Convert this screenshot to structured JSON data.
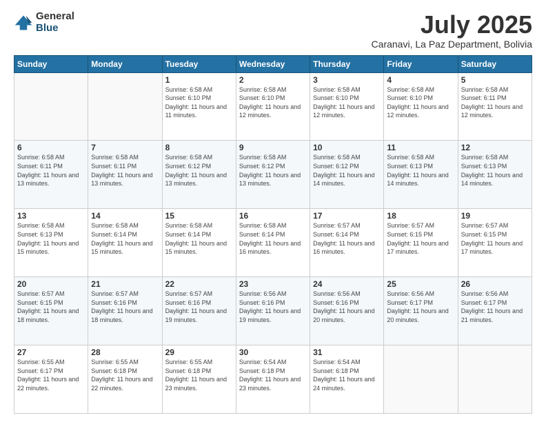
{
  "logo": {
    "general": "General",
    "blue": "Blue"
  },
  "header": {
    "month_year": "July 2025",
    "location": "Caranavi, La Paz Department, Bolivia"
  },
  "days_of_week": [
    "Sunday",
    "Monday",
    "Tuesday",
    "Wednesday",
    "Thursday",
    "Friday",
    "Saturday"
  ],
  "weeks": [
    [
      {
        "day": "",
        "sunrise": "",
        "sunset": "",
        "daylight": ""
      },
      {
        "day": "",
        "sunrise": "",
        "sunset": "",
        "daylight": ""
      },
      {
        "day": "1",
        "sunrise": "Sunrise: 6:58 AM",
        "sunset": "Sunset: 6:10 PM",
        "daylight": "Daylight: 11 hours and 11 minutes."
      },
      {
        "day": "2",
        "sunrise": "Sunrise: 6:58 AM",
        "sunset": "Sunset: 6:10 PM",
        "daylight": "Daylight: 11 hours and 12 minutes."
      },
      {
        "day": "3",
        "sunrise": "Sunrise: 6:58 AM",
        "sunset": "Sunset: 6:10 PM",
        "daylight": "Daylight: 11 hours and 12 minutes."
      },
      {
        "day": "4",
        "sunrise": "Sunrise: 6:58 AM",
        "sunset": "Sunset: 6:10 PM",
        "daylight": "Daylight: 11 hours and 12 minutes."
      },
      {
        "day": "5",
        "sunrise": "Sunrise: 6:58 AM",
        "sunset": "Sunset: 6:11 PM",
        "daylight": "Daylight: 11 hours and 12 minutes."
      }
    ],
    [
      {
        "day": "6",
        "sunrise": "Sunrise: 6:58 AM",
        "sunset": "Sunset: 6:11 PM",
        "daylight": "Daylight: 11 hours and 13 minutes."
      },
      {
        "day": "7",
        "sunrise": "Sunrise: 6:58 AM",
        "sunset": "Sunset: 6:11 PM",
        "daylight": "Daylight: 11 hours and 13 minutes."
      },
      {
        "day": "8",
        "sunrise": "Sunrise: 6:58 AM",
        "sunset": "Sunset: 6:12 PM",
        "daylight": "Daylight: 11 hours and 13 minutes."
      },
      {
        "day": "9",
        "sunrise": "Sunrise: 6:58 AM",
        "sunset": "Sunset: 6:12 PM",
        "daylight": "Daylight: 11 hours and 13 minutes."
      },
      {
        "day": "10",
        "sunrise": "Sunrise: 6:58 AM",
        "sunset": "Sunset: 6:12 PM",
        "daylight": "Daylight: 11 hours and 14 minutes."
      },
      {
        "day": "11",
        "sunrise": "Sunrise: 6:58 AM",
        "sunset": "Sunset: 6:13 PM",
        "daylight": "Daylight: 11 hours and 14 minutes."
      },
      {
        "day": "12",
        "sunrise": "Sunrise: 6:58 AM",
        "sunset": "Sunset: 6:13 PM",
        "daylight": "Daylight: 11 hours and 14 minutes."
      }
    ],
    [
      {
        "day": "13",
        "sunrise": "Sunrise: 6:58 AM",
        "sunset": "Sunset: 6:13 PM",
        "daylight": "Daylight: 11 hours and 15 minutes."
      },
      {
        "day": "14",
        "sunrise": "Sunrise: 6:58 AM",
        "sunset": "Sunset: 6:14 PM",
        "daylight": "Daylight: 11 hours and 15 minutes."
      },
      {
        "day": "15",
        "sunrise": "Sunrise: 6:58 AM",
        "sunset": "Sunset: 6:14 PM",
        "daylight": "Daylight: 11 hours and 15 minutes."
      },
      {
        "day": "16",
        "sunrise": "Sunrise: 6:58 AM",
        "sunset": "Sunset: 6:14 PM",
        "daylight": "Daylight: 11 hours and 16 minutes."
      },
      {
        "day": "17",
        "sunrise": "Sunrise: 6:57 AM",
        "sunset": "Sunset: 6:14 PM",
        "daylight": "Daylight: 11 hours and 16 minutes."
      },
      {
        "day": "18",
        "sunrise": "Sunrise: 6:57 AM",
        "sunset": "Sunset: 6:15 PM",
        "daylight": "Daylight: 11 hours and 17 minutes."
      },
      {
        "day": "19",
        "sunrise": "Sunrise: 6:57 AM",
        "sunset": "Sunset: 6:15 PM",
        "daylight": "Daylight: 11 hours and 17 minutes."
      }
    ],
    [
      {
        "day": "20",
        "sunrise": "Sunrise: 6:57 AM",
        "sunset": "Sunset: 6:15 PM",
        "daylight": "Daylight: 11 hours and 18 minutes."
      },
      {
        "day": "21",
        "sunrise": "Sunrise: 6:57 AM",
        "sunset": "Sunset: 6:16 PM",
        "daylight": "Daylight: 11 hours and 18 minutes."
      },
      {
        "day": "22",
        "sunrise": "Sunrise: 6:57 AM",
        "sunset": "Sunset: 6:16 PM",
        "daylight": "Daylight: 11 hours and 19 minutes."
      },
      {
        "day": "23",
        "sunrise": "Sunrise: 6:56 AM",
        "sunset": "Sunset: 6:16 PM",
        "daylight": "Daylight: 11 hours and 19 minutes."
      },
      {
        "day": "24",
        "sunrise": "Sunrise: 6:56 AM",
        "sunset": "Sunset: 6:16 PM",
        "daylight": "Daylight: 11 hours and 20 minutes."
      },
      {
        "day": "25",
        "sunrise": "Sunrise: 6:56 AM",
        "sunset": "Sunset: 6:17 PM",
        "daylight": "Daylight: 11 hours and 20 minutes."
      },
      {
        "day": "26",
        "sunrise": "Sunrise: 6:56 AM",
        "sunset": "Sunset: 6:17 PM",
        "daylight": "Daylight: 11 hours and 21 minutes."
      }
    ],
    [
      {
        "day": "27",
        "sunrise": "Sunrise: 6:55 AM",
        "sunset": "Sunset: 6:17 PM",
        "daylight": "Daylight: 11 hours and 22 minutes."
      },
      {
        "day": "28",
        "sunrise": "Sunrise: 6:55 AM",
        "sunset": "Sunset: 6:18 PM",
        "daylight": "Daylight: 11 hours and 22 minutes."
      },
      {
        "day": "29",
        "sunrise": "Sunrise: 6:55 AM",
        "sunset": "Sunset: 6:18 PM",
        "daylight": "Daylight: 11 hours and 23 minutes."
      },
      {
        "day": "30",
        "sunrise": "Sunrise: 6:54 AM",
        "sunset": "Sunset: 6:18 PM",
        "daylight": "Daylight: 11 hours and 23 minutes."
      },
      {
        "day": "31",
        "sunrise": "Sunrise: 6:54 AM",
        "sunset": "Sunset: 6:18 PM",
        "daylight": "Daylight: 11 hours and 24 minutes."
      },
      {
        "day": "",
        "sunrise": "",
        "sunset": "",
        "daylight": ""
      },
      {
        "day": "",
        "sunrise": "",
        "sunset": "",
        "daylight": ""
      }
    ]
  ]
}
